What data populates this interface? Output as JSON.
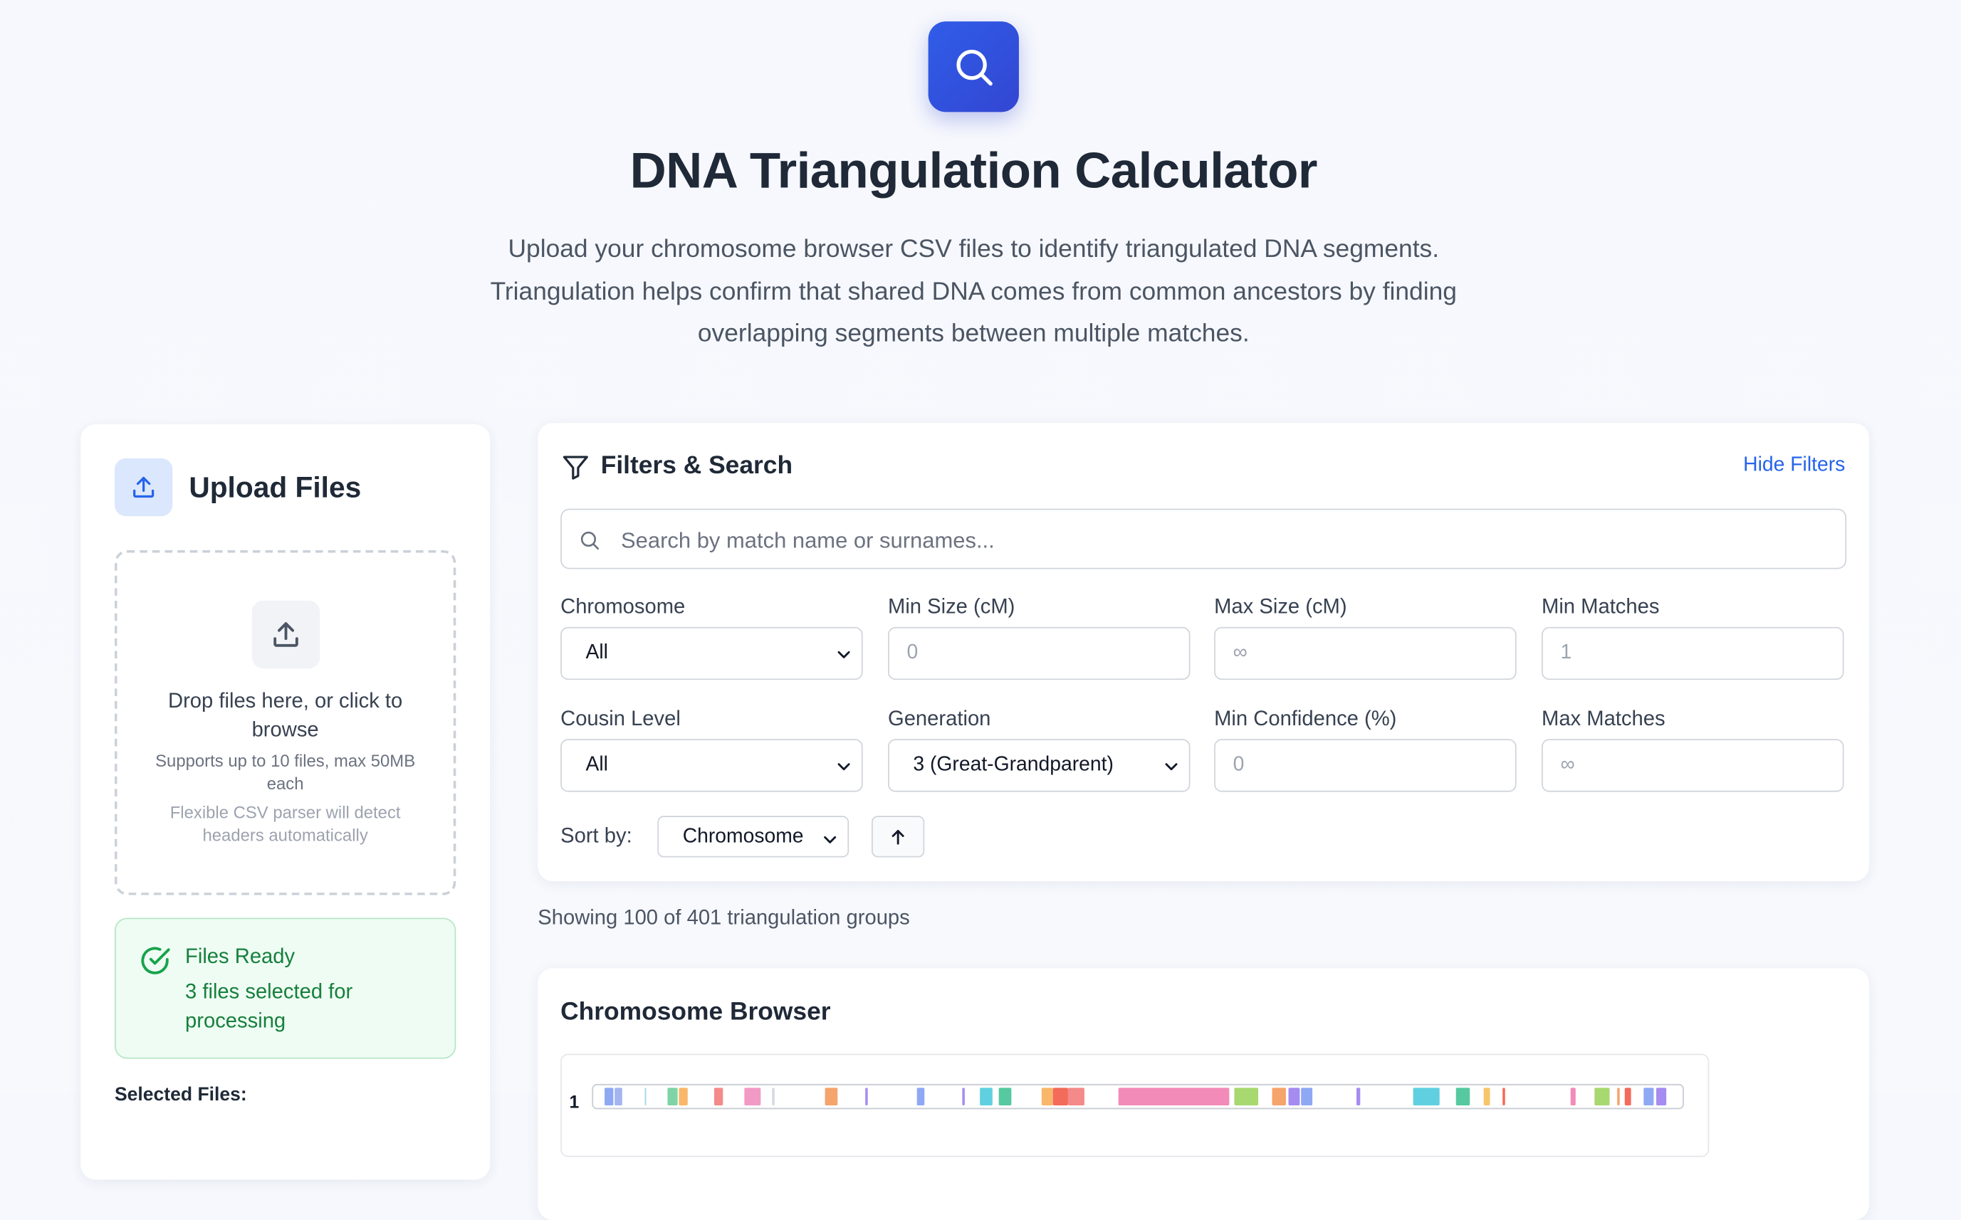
{
  "header": {
    "logo_icon": "search-icon",
    "title": "DNA Triangulation Calculator",
    "subtitle": "Upload your chromosome browser CSV files to identify triangulated DNA segments. Triangulation helps confirm that shared DNA comes from common ancestors by finding overlapping segments between multiple matches."
  },
  "upload": {
    "title": "Upload Files",
    "dropzone_text": "Drop files here, or click to browse",
    "dropzone_limits": "Supports up to 10 files, max 50MB each",
    "dropzone_hint": "Flexible CSV parser will detect headers automatically",
    "ready_title": "Files Ready",
    "ready_desc": "3 files selected for processing",
    "selected_label": "Selected Files:"
  },
  "filters": {
    "title": "Filters & Search",
    "hide_label": "Hide Filters",
    "search_placeholder": "Search by match name or surnames...",
    "chromosome": {
      "label": "Chromosome",
      "value": "All"
    },
    "min_size": {
      "label": "Min Size (cM)",
      "placeholder": "0"
    },
    "max_size": {
      "label": "Max Size (cM)",
      "placeholder": "∞"
    },
    "min_matches": {
      "label": "Min Matches",
      "placeholder": "1"
    },
    "cousin_level": {
      "label": "Cousin Level",
      "value": "All"
    },
    "generation": {
      "label": "Generation",
      "value": "3 (Great-Grandparent)"
    },
    "min_confidence": {
      "label": "Min Confidence (%)",
      "placeholder": "0"
    },
    "max_matches": {
      "label": "Max Matches",
      "placeholder": "∞"
    },
    "sort_label": "Sort by:",
    "sort_value": "Chromosome",
    "sort_direction_icon": "arrow-up-icon"
  },
  "results": {
    "showing": "Showing 100 of 401 triangulation groups"
  },
  "browser": {
    "title": "Chromosome Browser",
    "chromosome_label": "1",
    "segments": [
      {
        "start": 0.01,
        "end": 0.018,
        "color": "#8fa8f4"
      },
      {
        "start": 0.02,
        "end": 0.027,
        "color": "#a4b4f0"
      },
      {
        "start": 0.047,
        "end": 0.049,
        "color": "#9ad6e8"
      },
      {
        "start": 0.069,
        "end": 0.078,
        "color": "#7fd4a5"
      },
      {
        "start": 0.079,
        "end": 0.087,
        "color": "#f8b76a"
      },
      {
        "start": 0.111,
        "end": 0.12,
        "color": "#f48a8a"
      },
      {
        "start": 0.139,
        "end": 0.154,
        "color": "#f29ac6"
      },
      {
        "start": 0.165,
        "end": 0.166,
        "color": "#d5d8e0"
      },
      {
        "start": 0.213,
        "end": 0.225,
        "color": "#f5a46c"
      },
      {
        "start": 0.25,
        "end": 0.253,
        "color": "#a68cf0"
      },
      {
        "start": 0.298,
        "end": 0.305,
        "color": "#8fa8f4"
      },
      {
        "start": 0.34,
        "end": 0.342,
        "color": "#a68cf0"
      },
      {
        "start": 0.356,
        "end": 0.368,
        "color": "#60d0e0"
      },
      {
        "start": 0.373,
        "end": 0.385,
        "color": "#56c9a0"
      },
      {
        "start": 0.413,
        "end": 0.423,
        "color": "#f8b76a"
      },
      {
        "start": 0.423,
        "end": 0.437,
        "color": "#f36b5a"
      },
      {
        "start": 0.437,
        "end": 0.452,
        "color": "#f48a8a"
      },
      {
        "start": 0.484,
        "end": 0.586,
        "color": "#f28bb8"
      },
      {
        "start": 0.59,
        "end": 0.612,
        "color": "#a8d870"
      },
      {
        "start": 0.625,
        "end": 0.638,
        "color": "#f5a46c"
      },
      {
        "start": 0.64,
        "end": 0.651,
        "color": "#a68cf0"
      },
      {
        "start": 0.652,
        "end": 0.662,
        "color": "#8fa8f4"
      },
      {
        "start": 0.703,
        "end": 0.706,
        "color": "#a68cf0"
      },
      {
        "start": 0.755,
        "end": 0.78,
        "color": "#60d0e0"
      },
      {
        "start": 0.795,
        "end": 0.807,
        "color": "#56c9a0"
      },
      {
        "start": 0.82,
        "end": 0.826,
        "color": "#f8c56a"
      },
      {
        "start": 0.838,
        "end": 0.84,
        "color": "#f36b5a"
      },
      {
        "start": 0.9,
        "end": 0.905,
        "color": "#f28bb8"
      },
      {
        "start": 0.922,
        "end": 0.936,
        "color": "#a8d870"
      },
      {
        "start": 0.943,
        "end": 0.946,
        "color": "#f5a46c"
      },
      {
        "start": 0.95,
        "end": 0.956,
        "color": "#f36b5a"
      },
      {
        "start": 0.968,
        "end": 0.977,
        "color": "#8fa8f4"
      },
      {
        "start": 0.979,
        "end": 0.988,
        "color": "#a68cf0"
      }
    ]
  }
}
